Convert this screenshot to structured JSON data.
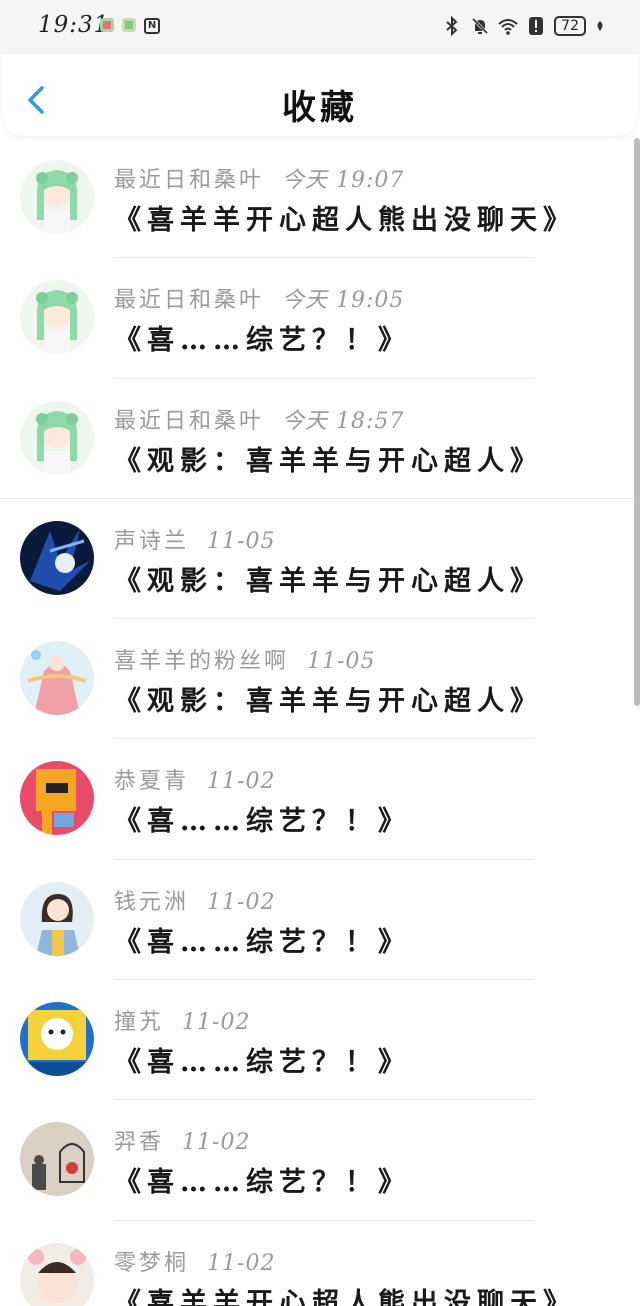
{
  "status": {
    "time": "19:31",
    "battery": "72"
  },
  "header": {
    "title": "收藏"
  },
  "favorites": [
    {
      "author": "最近日和桑叶",
      "time": "今天 19:07",
      "title": "《喜羊羊开心超人熊出没聊天》"
    },
    {
      "author": "最近日和桑叶",
      "time": "今天 19:05",
      "title": "《喜……综艺？！》"
    },
    {
      "author": "最近日和桑叶",
      "time": "今天 18:57",
      "title": "《观影：喜羊羊与开心超人》"
    },
    {
      "author": "声诗兰",
      "time": "11-05",
      "title": "《观影：喜羊羊与开心超人》"
    },
    {
      "author": "喜羊羊的粉丝啊",
      "time": "11-05",
      "title": "《观影：喜羊羊与开心超人》"
    },
    {
      "author": "恭夏青",
      "time": "11-02",
      "title": "《喜……综艺？！》"
    },
    {
      "author": "钱元洲",
      "time": "11-02",
      "title": "《喜……综艺？！》"
    },
    {
      "author": "撞艽",
      "time": "11-02",
      "title": "《喜……综艺？！》"
    },
    {
      "author": "羿香",
      "time": "11-02",
      "title": "《喜……综艺？！》"
    },
    {
      "author": "零梦桐",
      "time": "11-02",
      "title": "《喜羊羊开心超人熊出没聊天》"
    }
  ],
  "colors": {
    "accent": "#2f9ae0",
    "meta_text": "#9a9a9a",
    "title_text": "#1a1a1a"
  },
  "icons": {
    "back": "chevron-left-icon",
    "bluetooth": "bluetooth-icon",
    "mute": "bell-off-icon",
    "wifi": "wifi-icon",
    "alert": "alert-icon",
    "leaf": "leaf-icon"
  }
}
